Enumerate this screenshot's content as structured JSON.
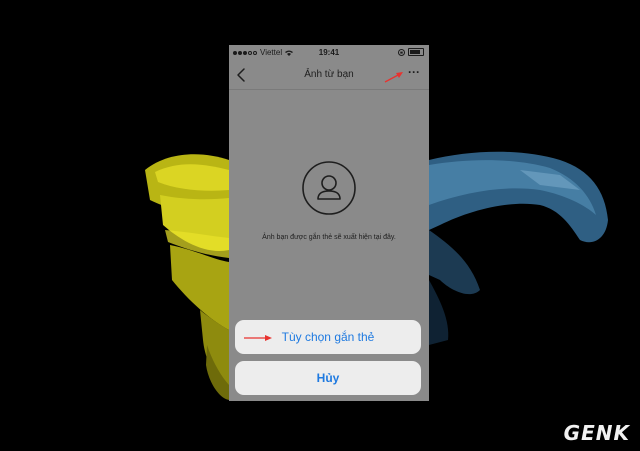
{
  "status_bar": {
    "carrier": "Viettel",
    "time": "19:41"
  },
  "nav": {
    "title": "Ảnh từ bạn",
    "back_icon": "chevron-left-icon",
    "more_label": "···"
  },
  "content": {
    "avatar_icon": "person-circle-icon",
    "empty_message": "Ảnh bạn được gắn thẻ sẽ xuất hiện tại đây."
  },
  "action_sheet": {
    "option_label": "Tùy chọn gắn thẻ",
    "cancel_label": "Hủy"
  },
  "colors": {
    "annotation_arrow": "#e8322f",
    "ios_blue": "#1f7ae0",
    "dim_overlay": "#8a8a8a"
  },
  "watermark": {
    "text": "GENK"
  }
}
